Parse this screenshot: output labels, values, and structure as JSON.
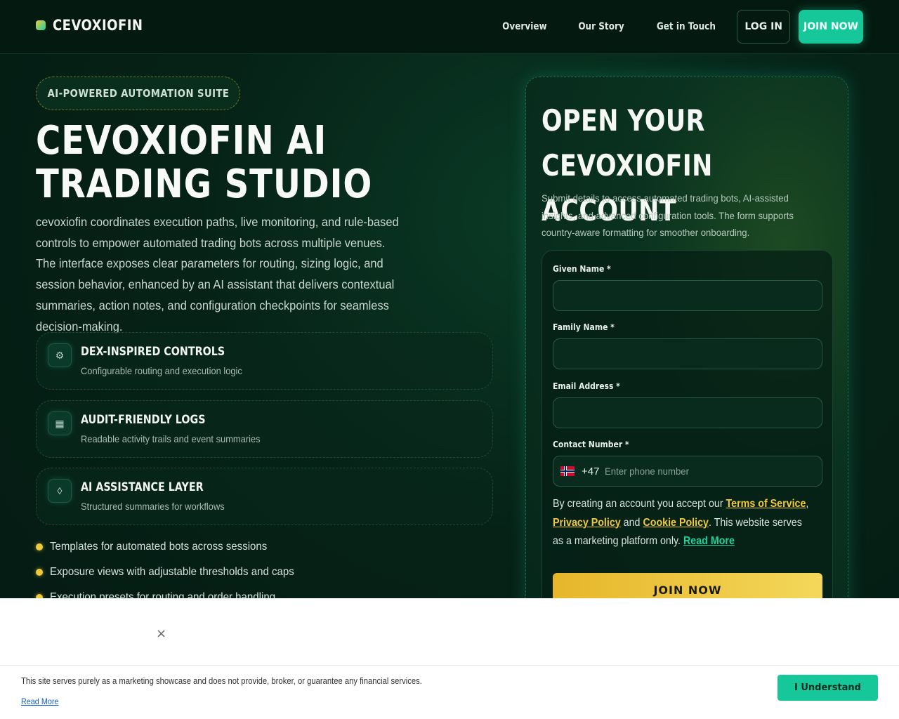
{
  "colors": {
    "brand_green": "#16c79a",
    "accent_yellow": "#f0c93c",
    "background_dark": "#041a12"
  },
  "header": {
    "brand": "CEVOXIOFIN",
    "nav": [
      "Overview",
      "Our Story",
      "Get in Touch"
    ],
    "login_label": "LOG IN",
    "join_label": "JOIN NOW"
  },
  "hero": {
    "badge": "AI-POWERED AUTOMATION SUITE",
    "title": "CEVOXIOFIN AI TRADING STUDIO",
    "description": "cevoxiofin coordinates execution paths, live monitoring, and rule-based controls to empower automated trading bots across multiple venues. The interface exposes clear parameters for routing, sizing logic, and session behavior, enhanced by an AI assistant that delivers contextual summaries, action notes, and configuration checkpoints for seamless decision-making."
  },
  "features": [
    {
      "icon": "sliders-icon",
      "glyph": "⚙",
      "title": "DEX-INSPIRED CONTROLS",
      "subtitle": "Configurable routing and execution logic"
    },
    {
      "icon": "log-icon",
      "glyph": "▦",
      "title": "AUDIT-FRIENDLY LOGS",
      "subtitle": "Readable activity trails and event summaries"
    },
    {
      "icon": "diamond-icon",
      "glyph": "◊",
      "title": "AI ASSISTANCE LAYER",
      "subtitle": "Structured summaries for workflows"
    }
  ],
  "bullets": [
    "Templates for automated bots across sessions",
    "Exposure views with adjustable thresholds and caps",
    "Execution presets for routing and order handling"
  ],
  "signup": {
    "title": "OPEN YOUR CEVOXIOFIN ACCOUNT",
    "description": "Submit details to access automated trading bots, AI-assisted insights, and advanced configuration tools. The form supports country-aware formatting for smoother onboarding.",
    "given_name_label": "Given Name *",
    "family_name_label": "Family Name *",
    "email_label": "Email Address *",
    "phone_label": "Contact Number *",
    "dial_code": "+47",
    "phone_placeholder": "Enter phone number",
    "terms_prefix": "By creating an account you accept our ",
    "terms_link": "Terms of Service",
    "terms_comma": ",",
    "privacy_link": "Privacy Policy",
    "and_text": " and ",
    "cookie_link": "Cookie Policy",
    "terms_suffix": ". This website serves as a marketing platform only. ",
    "read_more": "Read More",
    "submit_label": "JOIN NOW"
  },
  "cookie": {
    "close_glyph": "×",
    "text": "This site serves purely as a marketing showcase and does not provide, broker, or guarantee any financial services.",
    "read_more": "Read More",
    "button": "I Understand"
  }
}
